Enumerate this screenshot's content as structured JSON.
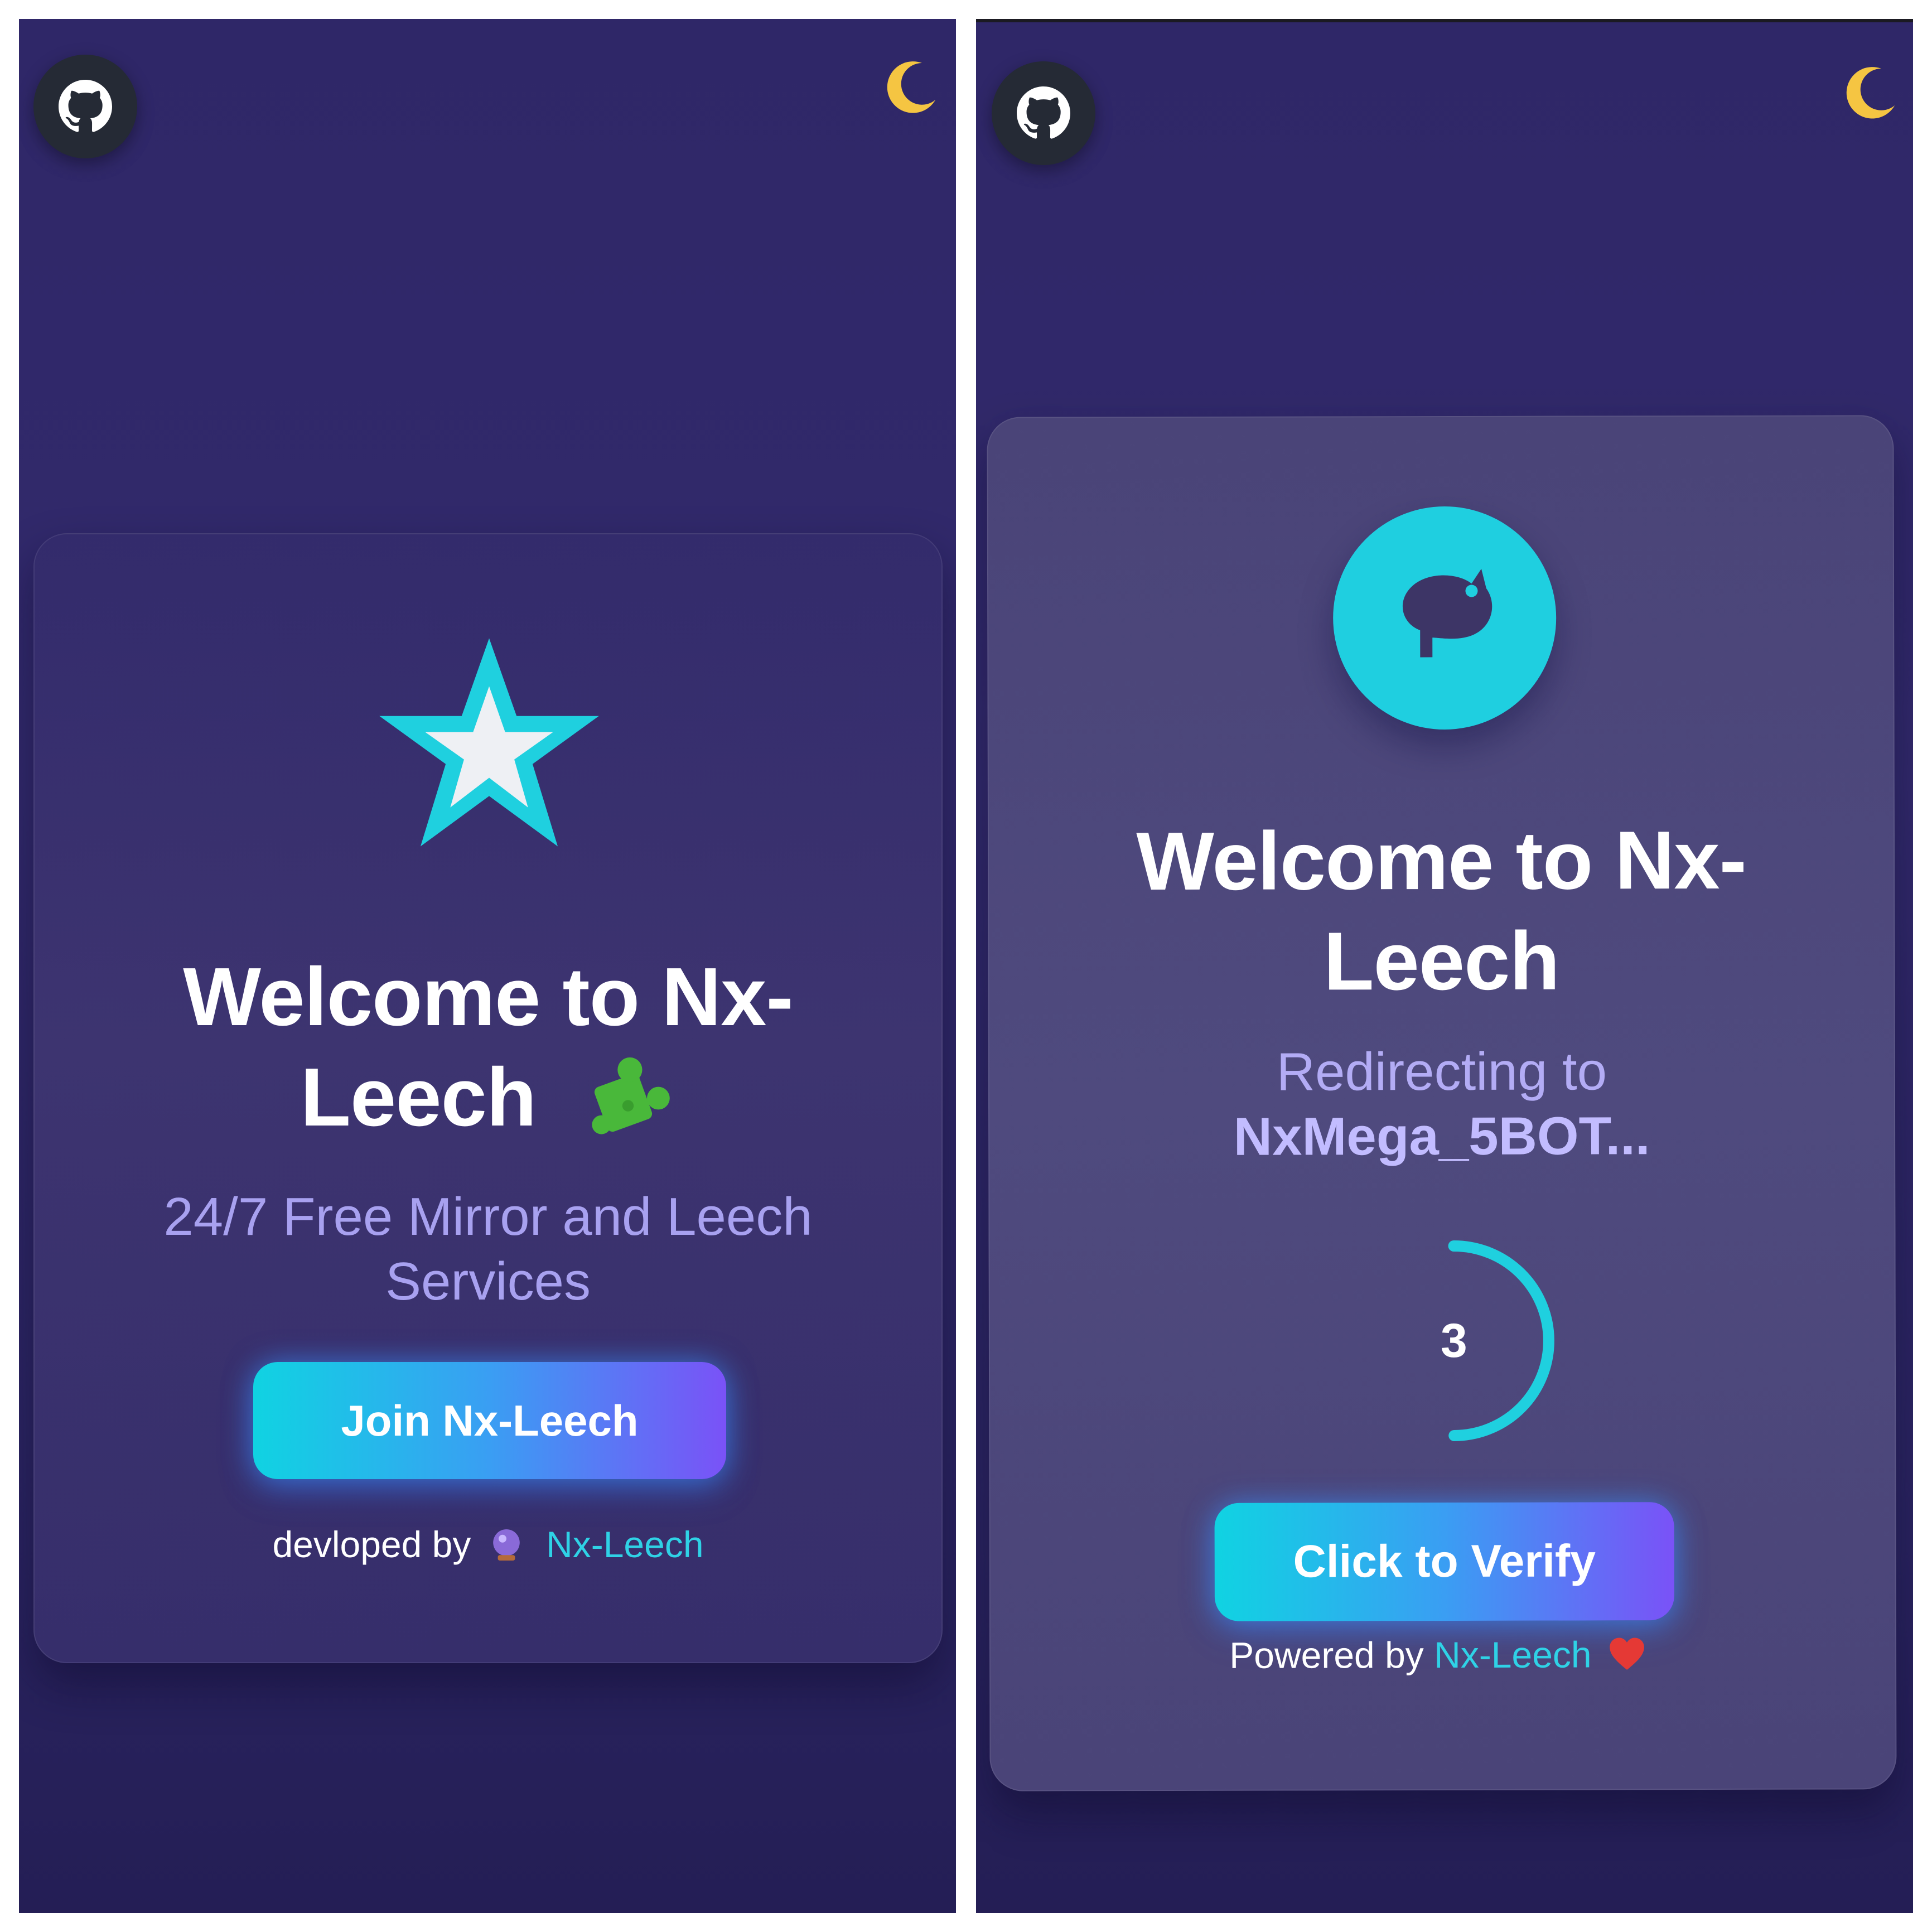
{
  "colors": {
    "background": "#2f2768",
    "card_left": "#3a3270",
    "card_right": "#4d4780",
    "accent_cyan": "#1fcfe0",
    "accent_purple": "#7a52f7",
    "subtitle": "#a8a1f0"
  },
  "left_screen": {
    "github_icon": "github-icon",
    "theme_icon": "moon-icon",
    "logo_icon": "star-icon",
    "title": "Welcome to Nx-Leech",
    "title_line1": "Welcome to Nx-",
    "title_line2": "Leech",
    "title_emoji_icon": "puzzle-piece-icon",
    "subtitle": "24/7 Free Mirror and Leech Services",
    "button_label": "Join Nx-Leech",
    "footer_prefix": "devloped by",
    "footer_icon": "crystal-ball-icon",
    "footer_link": "Nx-Leech"
  },
  "right_screen": {
    "github_icon": "github-icon",
    "theme_icon": "moon-icon",
    "logo_icon": "bot-logo-icon",
    "title_line1": "Welcome to Nx-",
    "title_line2": "Leech",
    "redirect_label": "Redirecting to",
    "redirect_target": "NxMega_5BOT...",
    "countdown_value": "3",
    "countdown_progress": 0.5,
    "button_label": "Click to Verify",
    "footer_prefix": "Powered by",
    "footer_link": "Nx-Leech",
    "footer_icon": "heart-icon"
  }
}
